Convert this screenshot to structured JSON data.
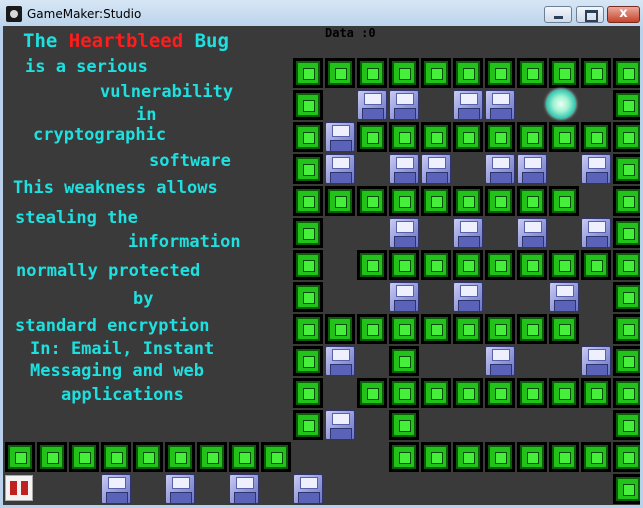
{
  "window": {
    "title": "GameMaker:Studio",
    "close_glyph": "x"
  },
  "hud": {
    "data_label": "Data :0"
  },
  "message": {
    "title_pre": "The ",
    "title_highlight": "Heartbleed",
    "title_post": " Bug",
    "lines": [
      "is a serious",
      "vulnerability",
      "in",
      "cryptographic",
      "software",
      "This weakness allows",
      "stealing the",
      "information",
      "normally protected",
      "by",
      "standard encryption",
      "In: Email, Instant",
      "Messaging and web",
      "applications"
    ]
  },
  "colors": {
    "text": "#1ee0e0",
    "highlight": "#ff1c1c",
    "block": "#21c21a",
    "background": "#3a3a3a"
  },
  "icons": {
    "app": "gamemaker-icon",
    "player": "glowing-orb",
    "data": "floppy-disk-icon",
    "lives": "pause-icon"
  }
}
